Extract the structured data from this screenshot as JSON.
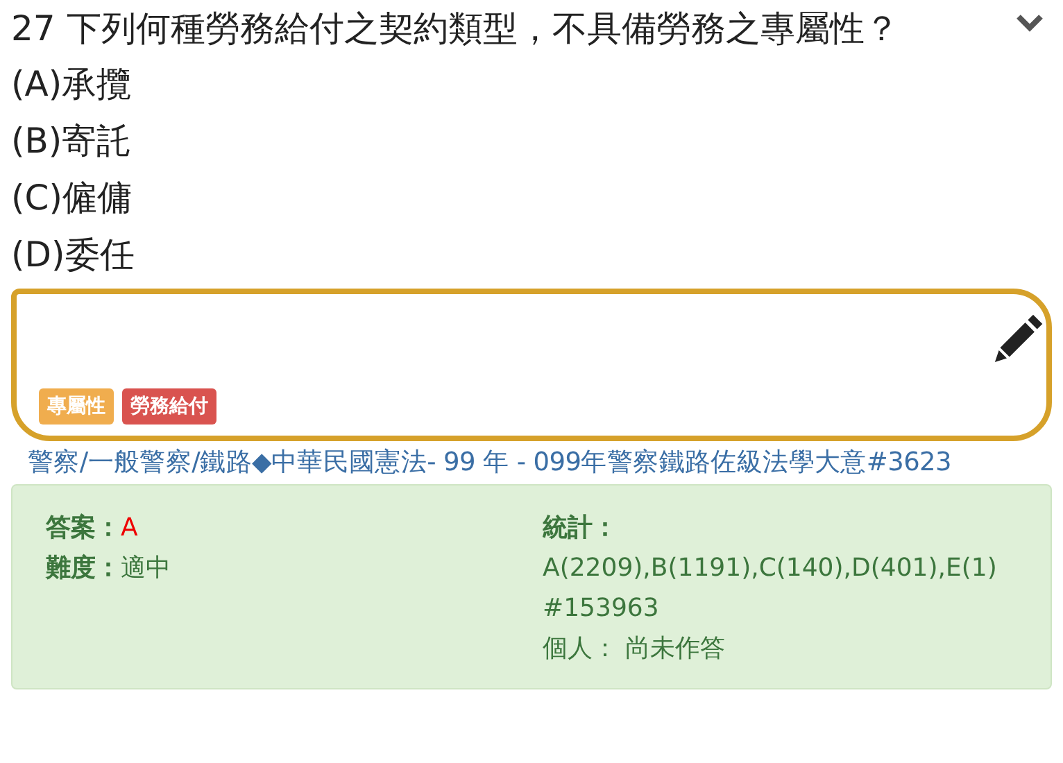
{
  "question": {
    "text": "27 下列何種勞務給付之契約類型，不具備勞務之專屬性？",
    "options": [
      "(A)承攬",
      "(B)寄託",
      "(C)僱傭",
      "(D)委任"
    ]
  },
  "tags": [
    {
      "label": "專屬性",
      "color": "#f0ad4e"
    },
    {
      "label": "勞務給付",
      "color": "#d9534f"
    }
  ],
  "source": "警察/一般警察/鐵路◆中華民國憲法- 99 年 - 099年警察鐵路佐級法學大意#3623",
  "info": {
    "answer_label": "答案：",
    "answer": "A",
    "difficulty_label": "難度：",
    "difficulty": "適中",
    "stats_label": "統計：",
    "stats": "A(2209),B(1191),C(140),D(401),E(1)",
    "id": "#153963",
    "personal": "個人： 尚未作答"
  }
}
